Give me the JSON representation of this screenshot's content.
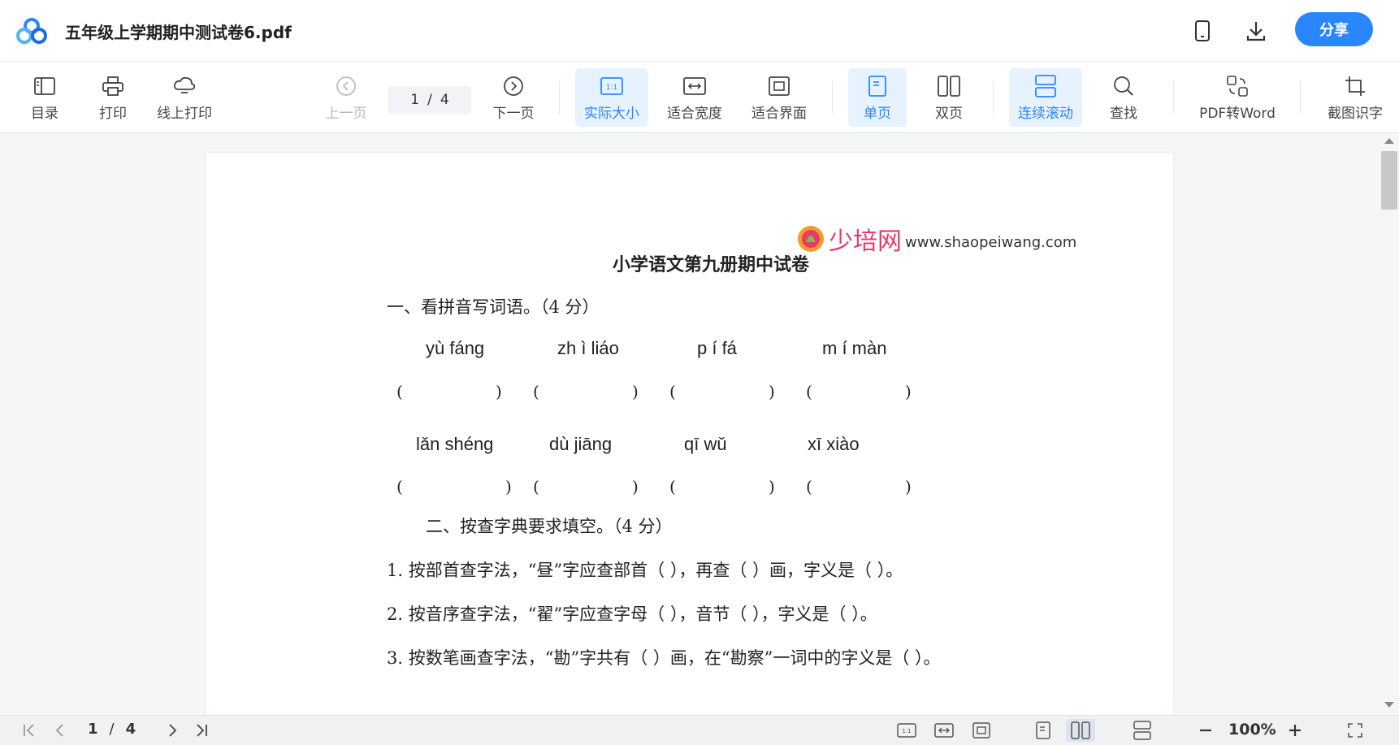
{
  "titlebar": {
    "title": "五年级上学期期中测试卷6.pdf",
    "share_label": "分享",
    "icons": [
      "app-logo",
      "mobile-icon",
      "download-icon"
    ]
  },
  "toolbar": {
    "catalog": "目录",
    "print": "打印",
    "online_print": "线上打印",
    "prev_page": "上一页",
    "current_page": "1",
    "page_sep": "/",
    "total_pages": "4",
    "next_page": "下一页",
    "actual_size": "实际大小",
    "fit_width": "适合宽度",
    "fit_page": "适合界面",
    "single_page": "单页",
    "double_page": "双页",
    "continuous_scroll": "连续滚动",
    "find": "查找",
    "pdf_to_word": "PDF转Word",
    "ocr": "截图识字"
  },
  "document": {
    "watermark_brand": "少培网",
    "watermark_url": "www.shaopeiwang.com",
    "title": "小学语文第九册期中试卷",
    "section1": "一、看拼音写词语。（4 分）",
    "pinyin_row1": [
      "yù fáng",
      "zh ì liáo",
      "p í fá",
      "m í màn"
    ],
    "pinyin_row2": [
      "lǎn shéng",
      "dù jiāng",
      "qī wǔ",
      "xī xiào"
    ],
    "paren_open": "(",
    "paren_close": ")",
    "section2": "二、按查字典要求填空。（4 分）",
    "q1": "1. 按部首查字法，“昼”字应查部首（ ），再查（ ）画，字义是（ ）。",
    "q2": "2. 按音序查字法，“翟”字应查字母（ ），音节（ ），字义是（ ）。",
    "q3": "3. 按数笔画查字法，“勘”字共有（ ）画，在“勘察”一词中的字义是（ ）。"
  },
  "statusbar": {
    "current_page": "1",
    "sep": "/",
    "total_pages": "4",
    "zoom": "100%"
  },
  "colors": {
    "accent": "#2a86ff",
    "active_bg": "#e7f2ff",
    "watermark": "#e8396b"
  }
}
